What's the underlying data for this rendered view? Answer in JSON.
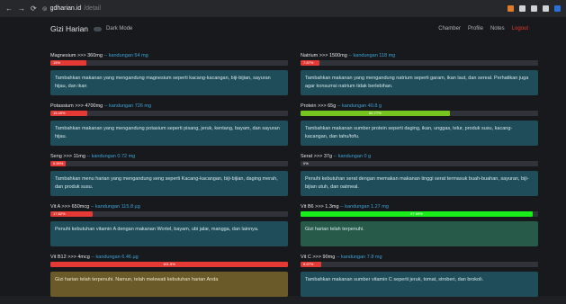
{
  "browser": {
    "host": "gdharian.id",
    "path": "/detail"
  },
  "nav": {
    "brand": "Gizi Harian",
    "dark_mode": "Dark Mode",
    "links": [
      "Chamber",
      "Profile",
      "Notes",
      "Logout"
    ]
  },
  "colors": {
    "red": "#e53935",
    "green": "#76c51f",
    "bright_green": "#19ee1a",
    "olive": "#6a5a2a",
    "teal": "#1f4d5a"
  },
  "nutrients": [
    {
      "label": "Magnesium >>> 360mg",
      "intake": "-- kandungan 54 mg",
      "pct_text": "15%",
      "pct": 0.15,
      "color": "#e53935",
      "advice": "Tambahkan makanan yang mengandung magnesium seperti kacang-kacangan, biji-bijian, sayuran hijau, dan ikan",
      "style": ""
    },
    {
      "label": "Natrium >>> 1500mg",
      "intake": "-- kandungan 118 mg",
      "pct_text": "7.87%",
      "pct": 0.0787,
      "color": "#e53935",
      "advice": "Tambahkan makanan yang mengandung natrium seperti garam, ikan laut, dan sereal. Perhatikan juga agar konsumsi natrium tidak berlebihan.",
      "style": ""
    },
    {
      "label": "Potassium >>> 4700mg",
      "intake": "-- kandungan 726 mg",
      "pct_text": "15.45%",
      "pct": 0.1545,
      "color": "#e53935",
      "advice": "Tambahkan makanan yang mengandung potasium seperti pisang, jeruk, kentang, bayam, dan sayuran hijau.",
      "style": ""
    },
    {
      "label": "Protein >>> 65g",
      "intake": "-- kandungan 40.8 g",
      "pct_text": "62.77%",
      "pct": 0.6277,
      "color": "#76c51f",
      "advice": "Tambahkan makanan sumber protein seperti daging, ikan, unggas, telur, produk susu, kacang-kacangan, dan tahu/tofu.",
      "style": ""
    },
    {
      "label": "Seng >>> 11mg",
      "intake": "-- kandungan 0.72 mg",
      "pct_text": "6.55%",
      "pct": 0.0655,
      "color": "#e53935",
      "advice": "Tambahkan menu harian yang mengandung seng seperti Kacang-kacangan, biji-bijian, daging merah, dan produk susu.",
      "style": ""
    },
    {
      "label": "Serat >>> 37g",
      "intake": "-- kandungan 0 g",
      "pct_text": "0%",
      "pct": 0,
      "color": "#e53935",
      "advice": "Penuhi kebutuhan serat dengan memakan makanan tinggi serat termasuk buah-buahan, sayuran, biji-bijian utuh, dan oatmeal.",
      "style": ""
    },
    {
      "label": "Vit A >>> 650mcg",
      "intake": "-- kandungan 115.8 µg",
      "pct_text": "17.82%",
      "pct": 0.1782,
      "color": "#e53935",
      "advice": "Penuhi kebutuhan vitamin A dengan makanan Wortel, bayam, ubi jalar, mangga, dan lainnya.",
      "style": ""
    },
    {
      "label": "Vit B6 >>> 1.3mg",
      "intake": "-- kandungan 1.27 mg",
      "pct_text": "97.69%",
      "pct": 0.9769,
      "color": "#19ee1a",
      "advice": "Gizi harian telah terpenuhi.",
      "style": "green"
    },
    {
      "label": "Vit B12 >>> 4mcg",
      "intake": "-- kandungan 6.46 µg",
      "pct_text": "161.5%",
      "pct": 1.0,
      "color": "#e53935",
      "advice": "Gizi harian telah terpenuhi. Namun, telah melewati kebutuhan harian Anda",
      "style": "olive"
    },
    {
      "label": "Vit C >>> 90mg",
      "intake": "-- kandungan 7.8 mg",
      "pct_text": "8.67%",
      "pct": 0.0867,
      "color": "#e53935",
      "advice": "Tambahkan makanan sumber vitamin C seperti jeruk, tomat, stroberi, dan brokoli.",
      "style": ""
    }
  ]
}
